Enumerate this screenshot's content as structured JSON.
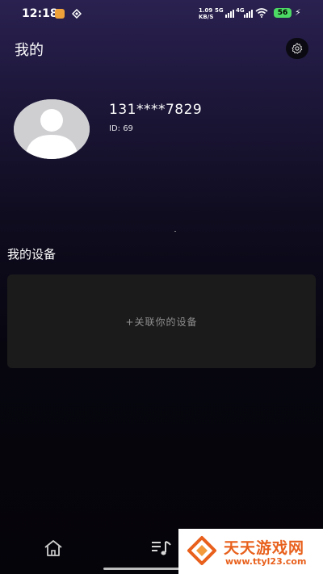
{
  "status_bar": {
    "time": "12:18",
    "net_speed_value": "1.09",
    "net_speed_unit": "KB/S",
    "sig1_label": "5G",
    "sig2_label": "4G",
    "battery": "56"
  },
  "header": {
    "title": "我的"
  },
  "profile": {
    "phone": "131****7829",
    "id_text": "ID: 69"
  },
  "devices": {
    "section_title": "我的设备",
    "link_label": "+关联你的设备"
  },
  "watermark": {
    "name": "天天游戏网",
    "url": "www.ttyl23.com"
  },
  "colors": {
    "accent_battery": "#4cd964",
    "watermark": "#e8601c",
    "card_bg": "#1b1b1b"
  }
}
